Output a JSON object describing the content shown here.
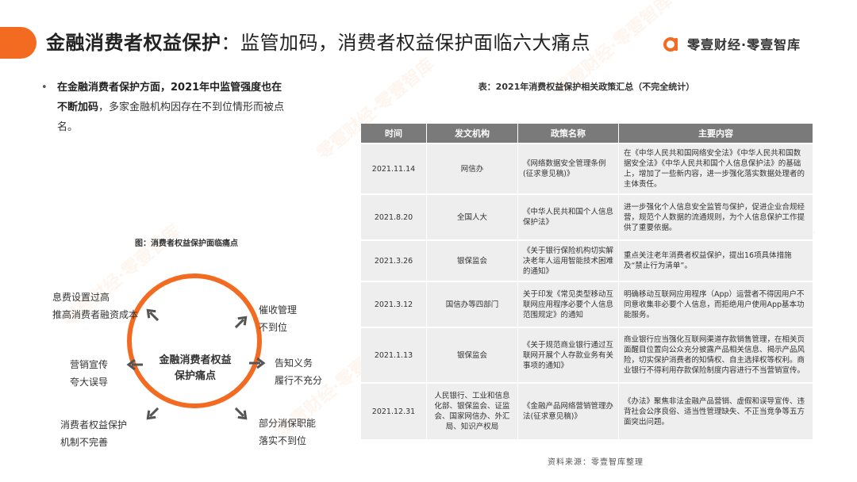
{
  "header": {
    "title_bold": "金融消费者权益保护",
    "title_rest": "：监管加码，消费者权益保护面临六大痛点",
    "brand": "零壹财经·零壹智库"
  },
  "bullet": {
    "strong": "在金融消费者保护方面，2021年中监管强度也在不断加码",
    "rest": "，多家金融机构因存在不到位情形而被点名。"
  },
  "diagram": {
    "caption": "图：消费者权益保护面临痛点",
    "center": [
      "金融消费者权益",
      "保护痛点"
    ],
    "points": [
      {
        "lines": [
          "息费设置过高",
          "推高消费者融资成本"
        ]
      },
      {
        "lines": [
          "营销宣传",
          "夸大误导"
        ]
      },
      {
        "lines": [
          "消费者权益保护",
          "机制不完善"
        ]
      },
      {
        "lines": [
          "催收管理",
          "不到位"
        ]
      },
      {
        "lines": [
          "告知义务",
          "履行不充分"
        ]
      },
      {
        "lines": [
          "部分消保职能",
          "落实不到位"
        ]
      }
    ]
  },
  "table": {
    "caption": "表：2021年消费权益保护相关政策汇总（不完全统计）",
    "headers": [
      "时间",
      "发文机构",
      "政策名称",
      "主要内容"
    ],
    "rows": [
      [
        "2021.11.14",
        "网信办",
        "《网络数据安全管理条例(征求意见稿)》",
        "在《中华人民共和国网络安全法》《中华人民共和国数据安全法》《中华人民共和国个人信息保护法》的基础上，增加了一些新内容，进一步强化落实数据处理者的主体责任。"
      ],
      [
        "2021.8.20",
        "全国人大",
        "《中华人民共和国个人信息保护法》",
        "进一步强化个人信息安全监管与保护，促进企业合规经营，规范个人数据的流通规则，为个人信息保护工作提供了重要依据。"
      ],
      [
        "2021.3.26",
        "银保监会",
        "《关于银行保险机构切实解决老年人运用智能技术困难的通知》",
        "重点关注老年消费者权益保护，提出16项具体措施及“禁止行为清单”。"
      ],
      [
        "2021.3.12",
        "国信办等四部门",
        "关于印发《常见类型移动互联网应用程序必要个人信息范围规定》的通知",
        "明确移动互联网应用程序（App）运营者不得因用户不同意收集非必要个人信息，而拒绝用户使用App基本功能服务。"
      ],
      [
        "2021.1.13",
        "银保监会",
        "《关于规范商业银行通过互联网开展个人存款业务有关事项的通知》",
        "商业银行应当强化互联网渠道存款销售管理，在相关页面醒目位置向公众充分披露产品相关信息、揭示产品风险，切实保护消费者的知情权、自主选择权等权利。商业银行不得利用存款保险制度内容进行不当营销宣传。"
      ],
      [
        "2021.12.31",
        "人民银行、工业和信息化部、银保监会、证监会、国家网信办、外汇局、知识产权局",
        "《金融产品网络营销管理办法(征求意见稿)》",
        "《办法》聚焦非法金融产品营销、虚假和误导宣传、违背社会公序良俗、适当性管理缺失、不正当竞争等五方面突出问题。"
      ]
    ]
  },
  "source": "资料来源：零壹智库整理",
  "colors": {
    "accent": "#f26b21",
    "header_bg": "#7a7a7a",
    "row_bg": "#eeeeee"
  },
  "icons": [
    "arrow-icon",
    "brand-logo-icon"
  ]
}
